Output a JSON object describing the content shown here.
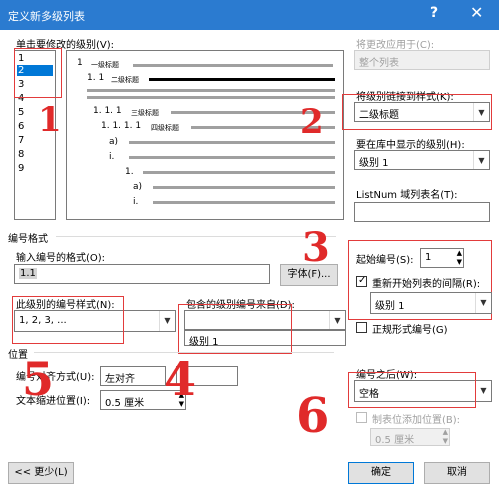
{
  "window": {
    "title": "定义新多级列表",
    "help_glyph": "?",
    "close_glyph": "✕"
  },
  "level_section": {
    "label": "单击要修改的级别(V):",
    "levels": [
      "1",
      "2",
      "3",
      "4",
      "5",
      "6",
      "7",
      "8",
      "9"
    ],
    "selected": "2"
  },
  "preview": {
    "rows": [
      {
        "num": "1",
        "text": "一级标题"
      },
      {
        "num": "1. 1",
        "text": "二级标题"
      },
      {
        "num": "1. 1. 1",
        "text": "三级标题"
      },
      {
        "num": "1. 1. 1. 1",
        "text": "四级标题"
      },
      {
        "num": "a)",
        "text": ""
      },
      {
        "num": "i.",
        "text": ""
      },
      {
        "num": "1.",
        "text": ""
      },
      {
        "num": "a)",
        "text": ""
      },
      {
        "num": "i.",
        "text": ""
      }
    ]
  },
  "right_panel": {
    "apply_to_label": "将更改应用于(C):",
    "apply_to_value": "整个列表",
    "link_style_label": "将级别链接到样式(K):",
    "link_style_value": "二级标题",
    "gallery_level_label": "要在库中显示的级别(H):",
    "gallery_level_value": "级别 1",
    "listnum_label": "ListNum 域列表名(T):",
    "listnum_value": ""
  },
  "number_format": {
    "group_label": "编号格式",
    "enter_format_label": "输入编号的格式(O):",
    "format_value": "1.1",
    "font_button": "字体(F)...",
    "style_label": "此级别的编号样式(N):",
    "style_value": "1, 2, 3, ...",
    "include_level_label": "包含的级别编号来自(D):",
    "include_level_value": "",
    "include_level_option": "级别 1",
    "start_at_label": "起始编号(S):",
    "start_at_value": "1",
    "restart_label": "重新开始列表的间隔(R):",
    "restart_checked": true,
    "restart_value": "级别 1",
    "legal_label": "正规形式编号(G)",
    "legal_checked": false
  },
  "position": {
    "group_label": "位置",
    "align_label": "编号对齐方式(U):",
    "align_value": "左对齐",
    "aligned_at_value": "",
    "indent_label": "文本缩进位置(I):",
    "indent_value": "0.5 厘米",
    "follow_label": "编号之后(W):",
    "follow_value": "空格",
    "tab_add_label": "制表位添加位置(B):",
    "tab_add_value": "0.5 厘米"
  },
  "buttons": {
    "less": "<< 更少(L)",
    "ok": "确定",
    "cancel": "取消"
  },
  "handwriting": [
    "1",
    "2",
    "3",
    "5",
    "4",
    "6"
  ]
}
